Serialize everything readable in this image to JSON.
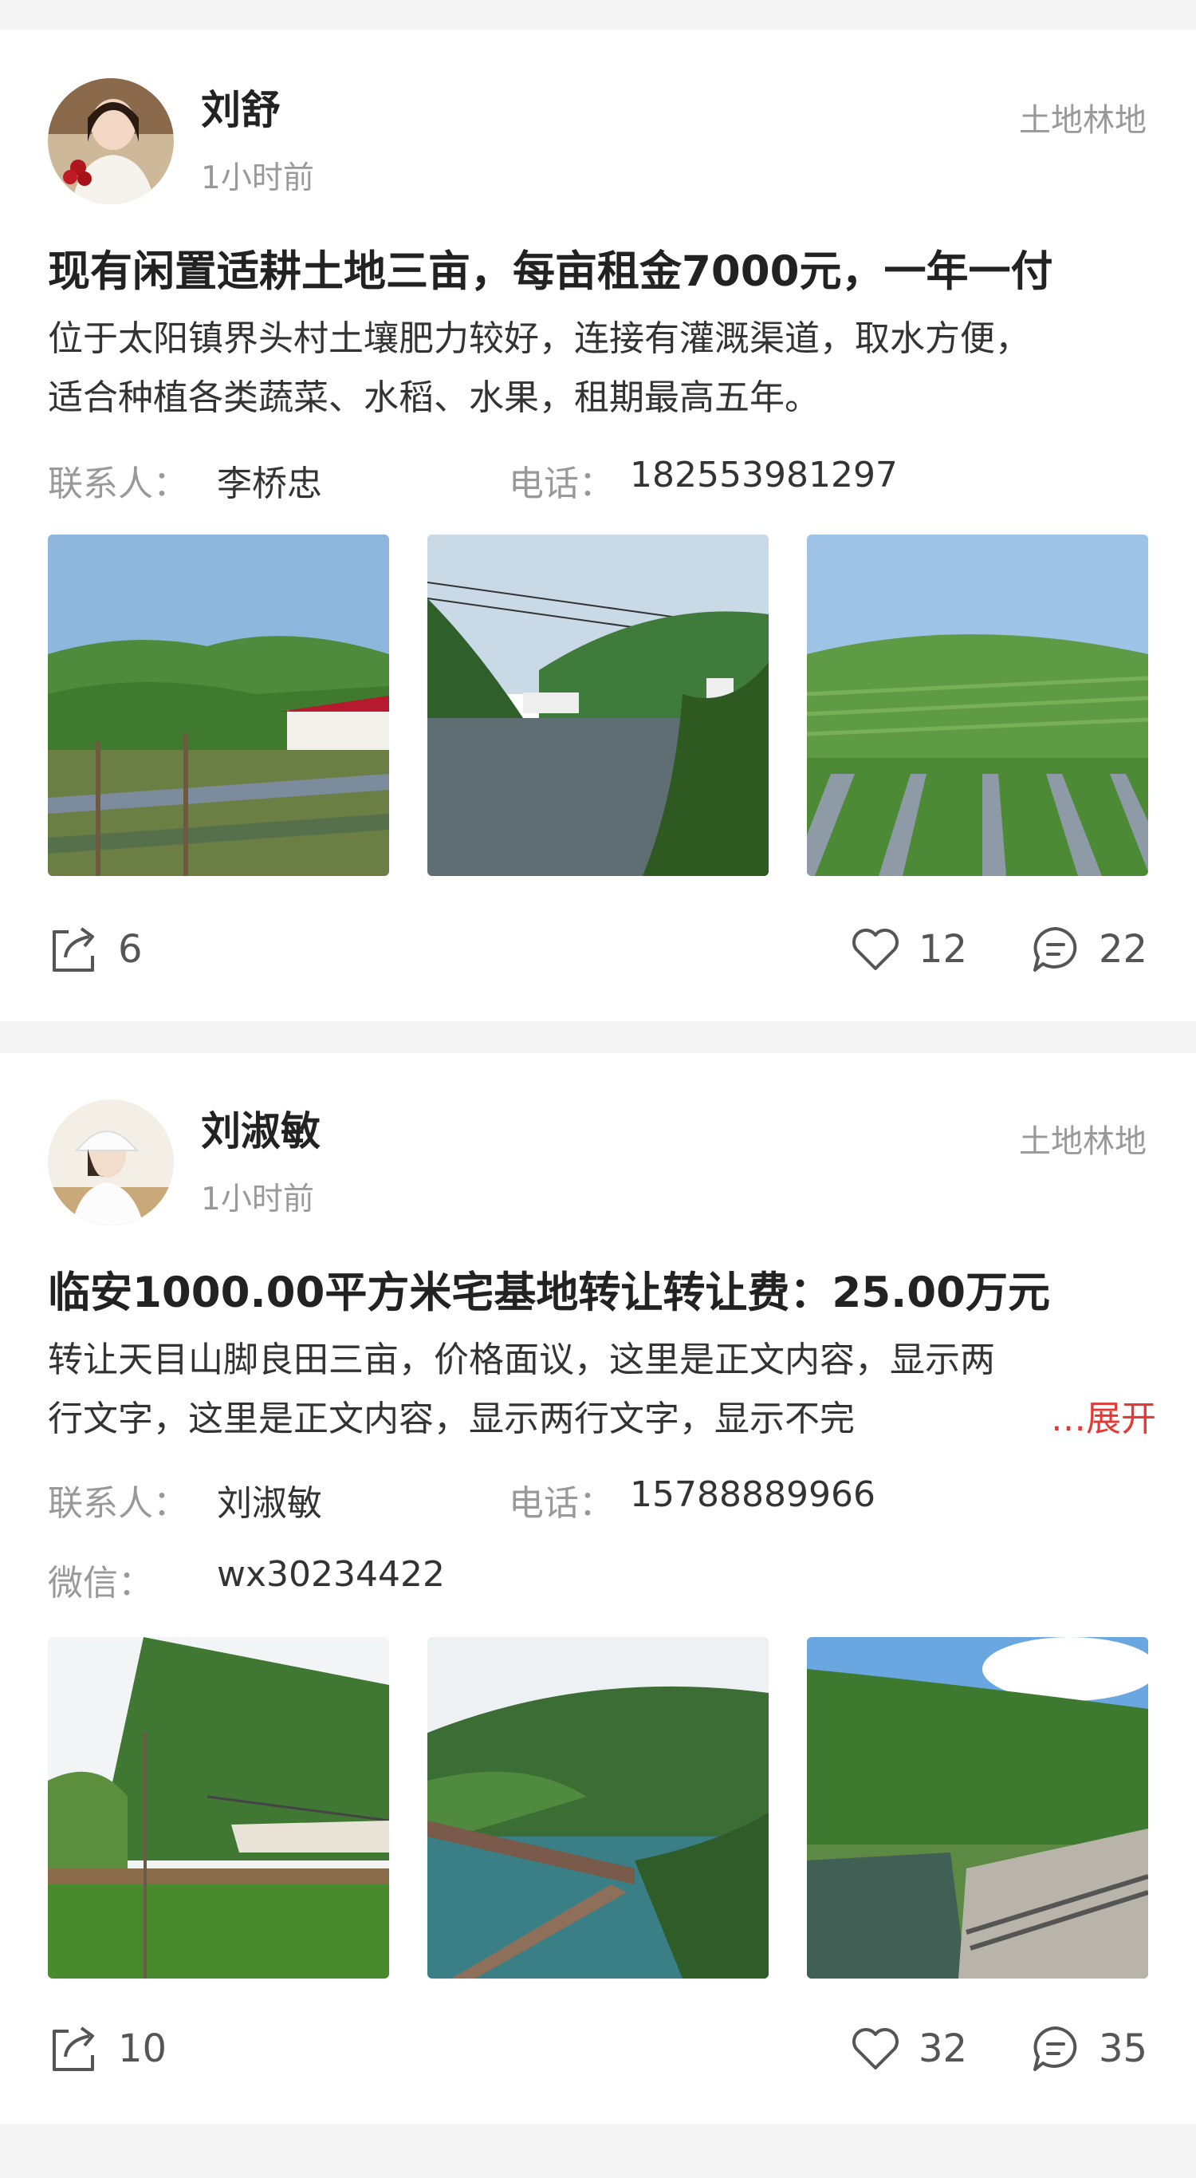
{
  "posts": [
    {
      "author": "刘舒",
      "time": "1小时前",
      "category": "土地林地",
      "title": "现有闲置适耕土地三亩，每亩租金7000元，一年一付",
      "body_line1": "位于太阳镇界头村土壤肥力较好，连接有灌溉渠道，取水方便，",
      "body_line2": "适合种植各类蔬菜、水稻、水果，租期最高五年。",
      "contact_label": "联系人：",
      "contact_name": "李桥忠",
      "phone_label": "电话：",
      "phone": "182553981297",
      "shares": "6",
      "likes": "12",
      "comments": "22"
    },
    {
      "author": "刘淑敏",
      "time": "1小时前",
      "category": "土地林地",
      "title": "临安1000.00平方米宅基地转让转让费：25.00万元",
      "body_line1": "转让天目山脚良田三亩，价格面议，这里是正文内容，显示两",
      "body_line2": "行文字，这里是正文内容，显示两行文字，显示不完",
      "expand_label": "…展开",
      "contact_label": "联系人：",
      "contact_name": "刘淑敏",
      "phone_label": "电话：",
      "phone": "15788889966",
      "wechat_label": "微信：",
      "wechat": "wx30234422",
      "shares": "10",
      "likes": "32",
      "comments": "35"
    }
  ],
  "icons": {
    "share": "share-icon",
    "like": "heart-icon",
    "comment": "comment-icon"
  },
  "colors": {
    "expand": "#e53935",
    "muted": "#999999",
    "background": "#f4f4f4"
  }
}
